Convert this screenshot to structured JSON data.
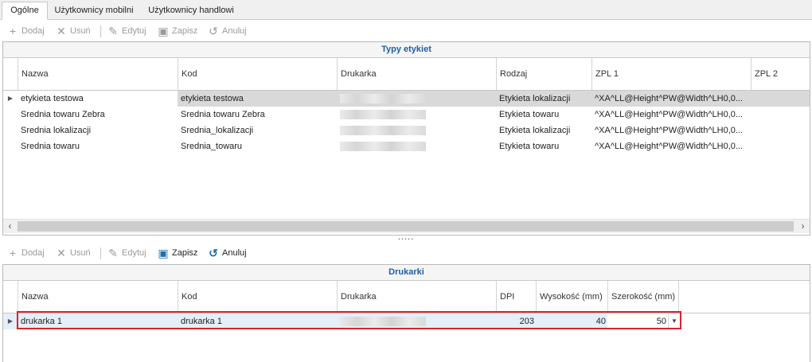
{
  "tabs": [
    {
      "label": "Ogólne",
      "active": true
    },
    {
      "label": "Użytkownicy mobilni",
      "active": false
    },
    {
      "label": "Użytkownicy handlowi",
      "active": false
    }
  ],
  "toolbar_top": {
    "add": "Dodaj",
    "delete": "Usuń",
    "edit": "Edytuj",
    "save": "Zapisz",
    "cancel": "Anuluj"
  },
  "toolbar_bottom": {
    "add": "Dodaj",
    "delete": "Usuń",
    "edit": "Edytuj",
    "save": "Zapisz",
    "cancel": "Anuluj"
  },
  "label_types": {
    "title": "Typy etykiet",
    "columns": [
      "Nazwa",
      "Kod",
      "Drukarka",
      "Rodzaj",
      "ZPL 1",
      "ZPL 2"
    ],
    "rows": [
      {
        "name": "etykieta testowa",
        "code": "etykieta testowa",
        "type": "Etykieta lokalizacji",
        "zpl1": "^XA^LL@Height^PW@Width^LH0,0..."
      },
      {
        "name": "Srednia towaru Zebra",
        "code": "Srednia towaru Zebra",
        "type": "Etykieta towaru",
        "zpl1": "^XA^LL@Height^PW@Width^LH0,0..."
      },
      {
        "name": "Srednia lokalizacji",
        "code": "Srednia_lokalizacji",
        "type": "Etykieta lokalizacji",
        "zpl1": "^XA^LL@Height^PW@Width^LH0,0..."
      },
      {
        "name": "Srednia towaru",
        "code": "Srednia_towaru",
        "type": "Etykieta towaru",
        "zpl1": "^XA^LL@Height^PW@Width^LH0,0..."
      }
    ]
  },
  "splitter": ".....",
  "printers": {
    "title": "Drukarki",
    "columns": [
      "Nazwa",
      "Kod",
      "Drukarka",
      "DPI",
      "Wysokość (mm)",
      "Szerokość (mm)"
    ],
    "rows": [
      {
        "name": "drukarka 1",
        "code": "drukarka 1",
        "dpi": "203",
        "height": "40",
        "width": "50"
      }
    ]
  },
  "colors": {
    "accent": "#1f5fa8",
    "highlight": "#d9232e",
    "selected_row": "#d9d9d9",
    "edited_row": "#e4effa"
  }
}
